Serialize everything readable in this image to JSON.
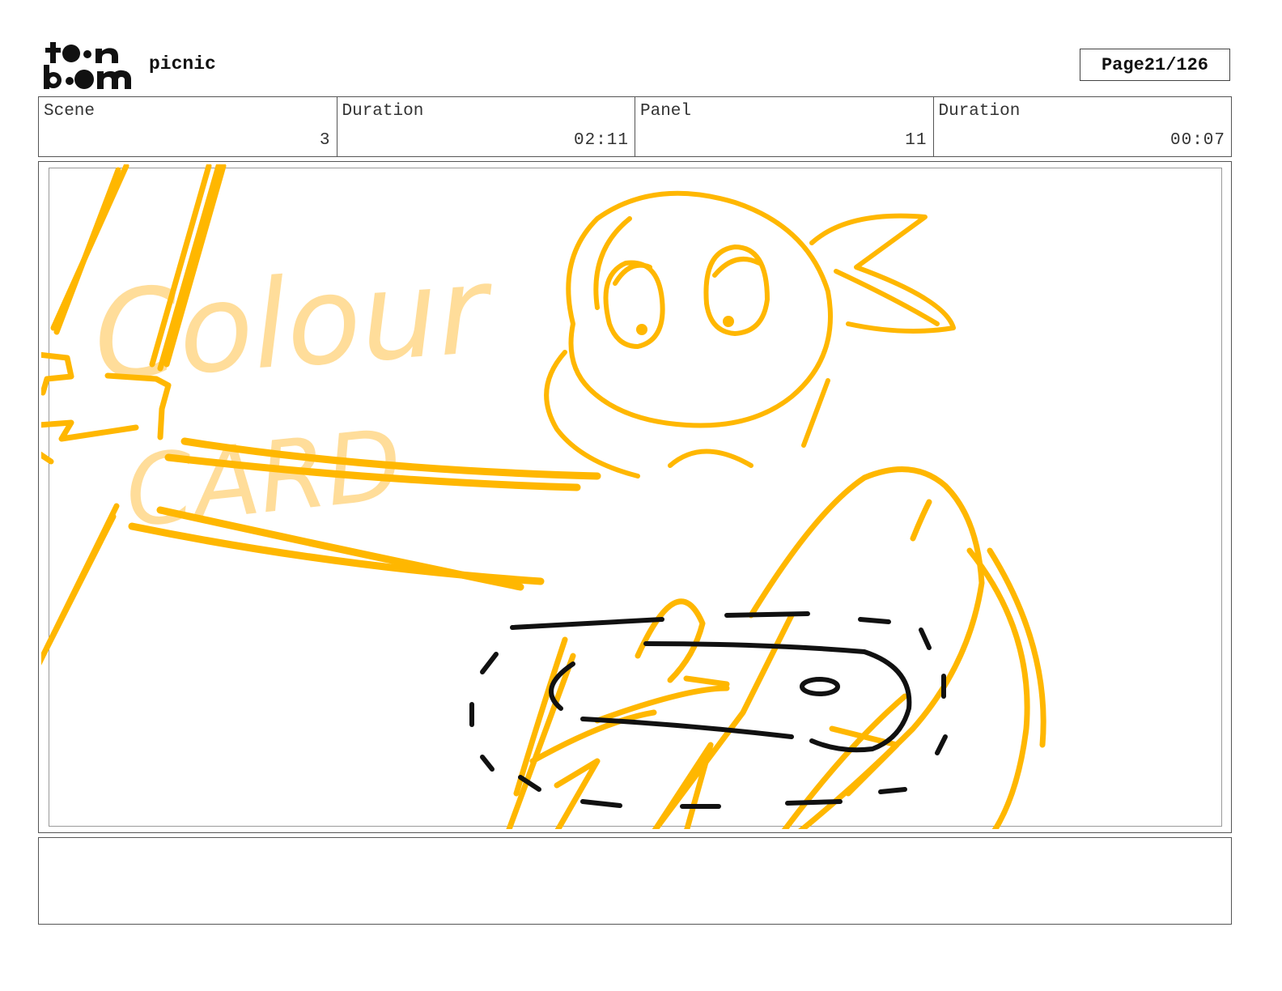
{
  "header": {
    "logo_text": "toon boom",
    "project": "picnic",
    "page_label": "Page",
    "page_number": "21/126"
  },
  "info": [
    {
      "label": "Scene",
      "value": "3"
    },
    {
      "label": "Duration",
      "value": "02:11"
    },
    {
      "label": "Panel",
      "value": "11"
    },
    {
      "label": "Duration",
      "value": "00:07"
    }
  ],
  "panel": {
    "sketch_text_line1": "Colour",
    "sketch_text_line2": "CARD",
    "colors": {
      "sketch": "#FFB700",
      "sketch_faded": "#FFD88A",
      "ink": "#111111"
    }
  },
  "notes": {
    "text": ""
  }
}
